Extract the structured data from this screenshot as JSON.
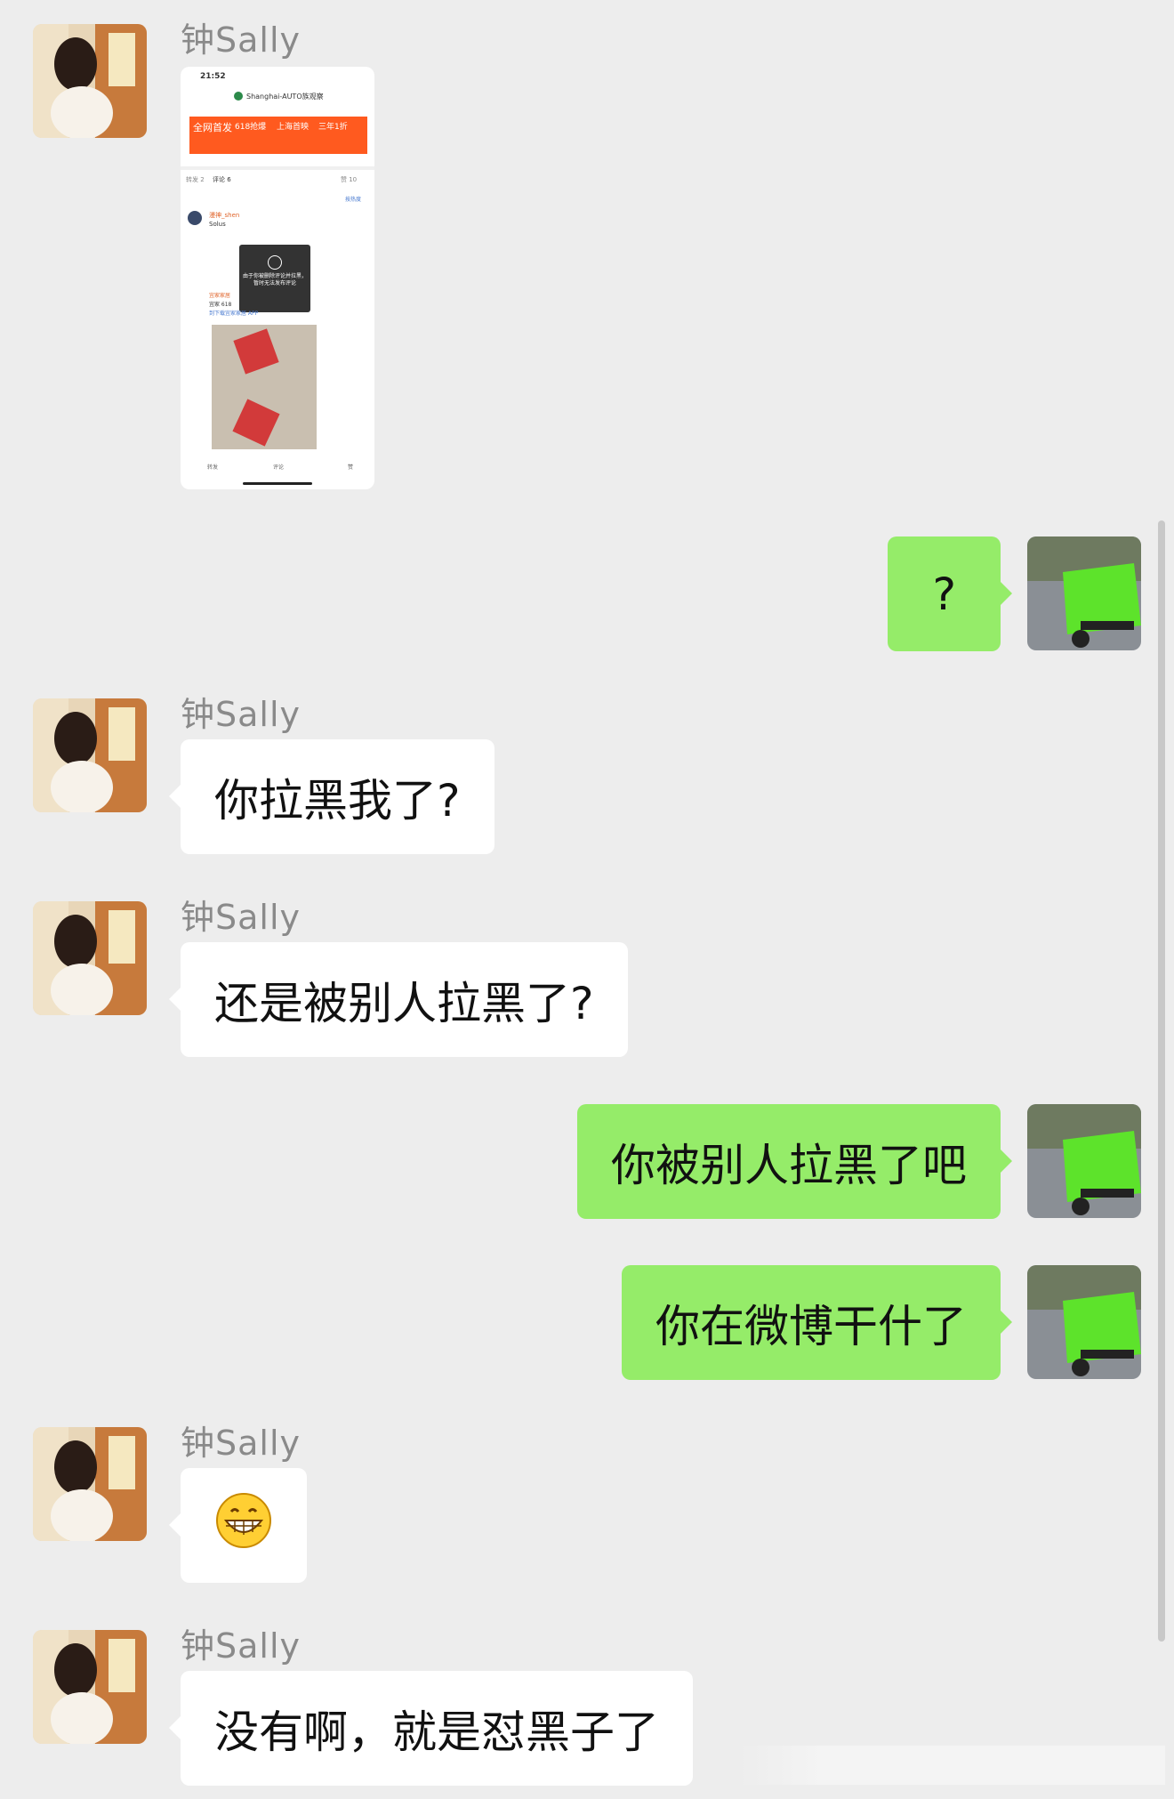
{
  "contact_name": "钟Sally",
  "messages": [
    {
      "side": "left",
      "sender": "钟Sally",
      "type": "image"
    },
    {
      "side": "right",
      "type": "text",
      "text": "?"
    },
    {
      "side": "left",
      "sender": "钟Sally",
      "type": "text",
      "text": "你拉黑我了?"
    },
    {
      "side": "left",
      "sender": "钟Sally",
      "type": "text",
      "text": "还是被别人拉黑了?"
    },
    {
      "side": "right",
      "type": "text",
      "text": "你被别人拉黑了吧"
    },
    {
      "side": "right",
      "type": "text",
      "text": "你在微博干什了"
    },
    {
      "side": "left",
      "sender": "钟Sally",
      "type": "emoji",
      "emoji": "grinning-face"
    },
    {
      "side": "left",
      "sender": "钟Sally",
      "type": "text",
      "text": "没有啊，就是怼黑子了"
    }
  ],
  "shot": {
    "time": "21:52",
    "account": "Shanghai-AUTO族观察",
    "banner": [
      "全网首发",
      "618抢爆",
      "上海首映",
      "三年1折"
    ],
    "tabs": [
      "转发 2",
      "评论 6",
      "赞 10"
    ],
    "sort": "按热度",
    "comment_user": "漫神_shen",
    "comment_text": "Solus",
    "toast": "由于你被删除评论并拉黑，暂时无法发布评论",
    "ad_name": "宜家家居",
    "ad_text": "宜家 618",
    "ad_link": "到下载宜家家居 APP",
    "actions": [
      "转发",
      "评论",
      "赞"
    ]
  },
  "colors": {
    "background": "#ededed",
    "self_bubble": "#95ec69",
    "other_bubble": "#ffffff",
    "name": "#8a8a8a"
  }
}
